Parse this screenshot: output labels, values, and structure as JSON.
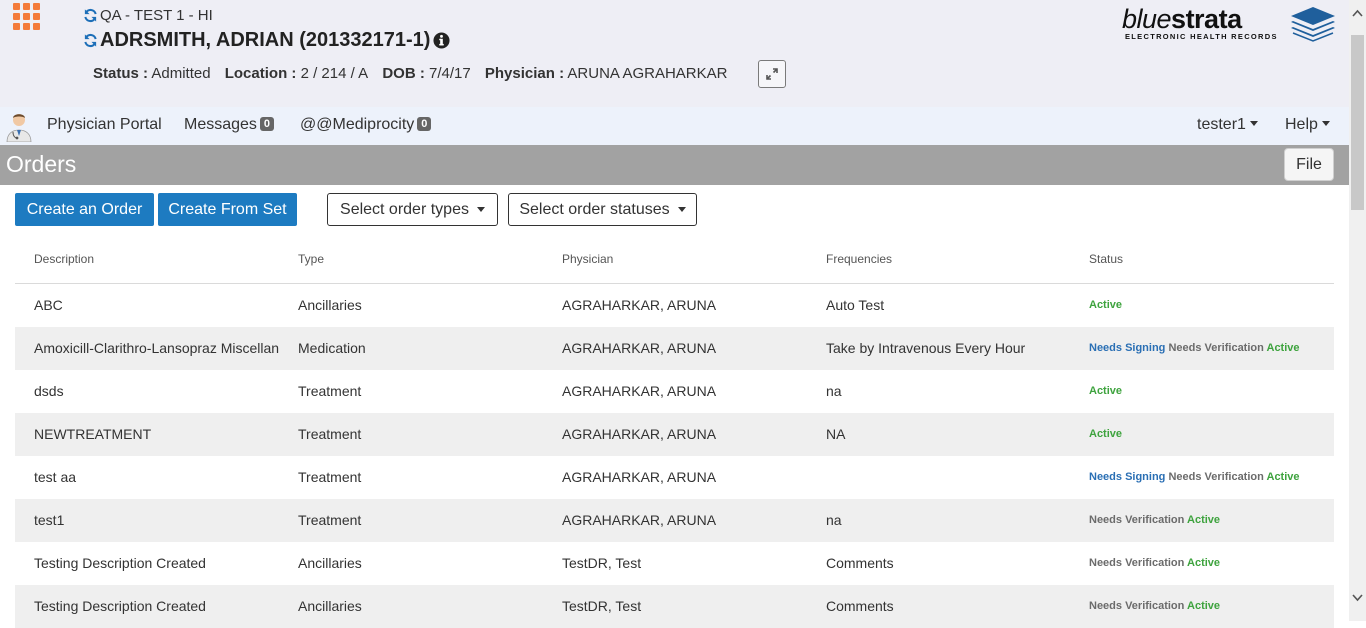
{
  "header": {
    "facility": "QA - TEST 1 - HI",
    "patient_name": "ADRSMITH, ADRIAN (201332171-1)",
    "status_label": "Status :",
    "status_value": "Admitted",
    "location_label": "Location :",
    "location_value": "2 / 214 / A",
    "dob_label": "DOB :",
    "dob_value": "7/4/17",
    "physician_label": "Physician :",
    "physician_value": "ARUNA AGRAHARKAR",
    "logo_light": "blue",
    "logo_bold": "strata",
    "logo_sub": "ELECTRONIC HEALTH RECORDS"
  },
  "nav": {
    "portal": "Physician Portal",
    "messages_label": "Messages",
    "messages_count": "0",
    "mediprocity_label": "@@Mediprocity",
    "mediprocity_count": "0",
    "user": "tester1",
    "help": "Help"
  },
  "orders": {
    "title": "Orders",
    "file_button": "File",
    "create_order": "Create an Order",
    "create_from_set": "Create From Set",
    "select_types": "Select order types",
    "select_statuses": "Select order statuses"
  },
  "table": {
    "headers": [
      "Description",
      "Type",
      "Physician",
      "Frequencies",
      "Status"
    ],
    "rows": [
      {
        "description": "ABC",
        "type": "Ancillaries",
        "physician": "AGRAHARKAR, ARUNA",
        "frequency": "Auto Test",
        "signing": "",
        "verification": "",
        "active": "Active"
      },
      {
        "description": "Amoxicill-Clarithro-Lansopraz Miscellan",
        "type": "Medication",
        "physician": "AGRAHARKAR, ARUNA",
        "frequency": "Take by Intravenous Every Hour",
        "signing": "Needs Signing",
        "verification": "Needs Verification",
        "active": "Active"
      },
      {
        "description": "dsds",
        "type": "Treatment",
        "physician": "AGRAHARKAR, ARUNA",
        "frequency": "na",
        "signing": "",
        "verification": "",
        "active": "Active"
      },
      {
        "description": "NEWTREATMENT",
        "type": "Treatment",
        "physician": "AGRAHARKAR, ARUNA",
        "frequency": "NA",
        "signing": "",
        "verification": "",
        "active": "Active"
      },
      {
        "description": "test aa",
        "type": "Treatment",
        "physician": "AGRAHARKAR, ARUNA",
        "frequency": "",
        "signing": "Needs Signing",
        "verification": "Needs Verification",
        "active": "Active"
      },
      {
        "description": "test1",
        "type": "Treatment",
        "physician": "AGRAHARKAR, ARUNA",
        "frequency": "na",
        "signing": "",
        "verification": "Needs Verification",
        "active": "Active"
      },
      {
        "description": "Testing Description Created",
        "type": "Ancillaries",
        "physician": "TestDR, Test",
        "frequency": "Comments",
        "signing": "",
        "verification": "Needs Verification",
        "active": "Active"
      },
      {
        "description": "Testing Description Created",
        "type": "Ancillaries",
        "physician": "TestDR, Test",
        "frequency": "Comments",
        "signing": "",
        "verification": "Needs Verification",
        "active": "Active"
      }
    ]
  },
  "colors": {
    "primary_button": "#1d7bc1",
    "status_signing": "#2a6fb4",
    "status_verification": "#6b6b6b",
    "status_active": "#3ea33e",
    "apps_icon": "#f47b3a"
  }
}
